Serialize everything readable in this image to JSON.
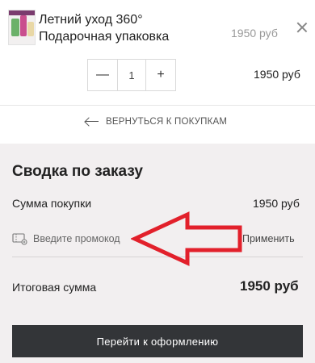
{
  "cart": {
    "item": {
      "title_line1": "Летний уход 360°",
      "title_line2": "Подарочная упаковка",
      "unit_price": "1950 руб",
      "quantity": "1",
      "decrement_label": "—",
      "increment_label": "+",
      "line_price": "1950 руб"
    },
    "back_link_label": "ВЕРНУТЬСЯ К ПОКУПКАМ"
  },
  "summary": {
    "title": "Сводка по заказу",
    "subtotal_label": "Сумма покупки",
    "subtotal_value": "1950 руб",
    "promo_placeholder": "Введите промокод",
    "apply_label": "Применить",
    "total_label": "Итоговая сумма",
    "total_value": "1950 руб",
    "checkout_label": "Перейти к оформлению"
  },
  "icons": {
    "remove": "close-icon",
    "back": "arrow-left-icon",
    "promo": "coupon-icon",
    "annotation": "red-arrow-annotation"
  },
  "colors": {
    "summary_background": "#f2eff0",
    "checkout_button": "#333538",
    "annotation_arrow": "#e2202b"
  }
}
